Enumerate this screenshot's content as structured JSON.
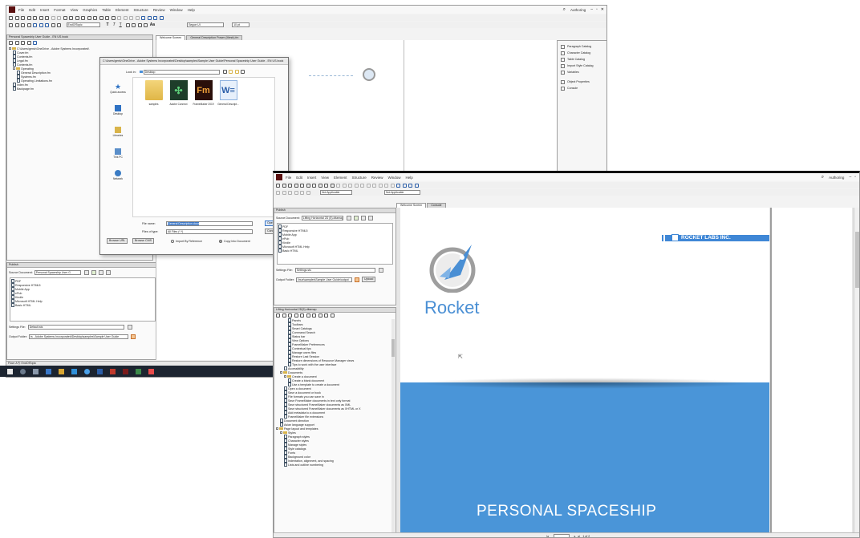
{
  "win1": {
    "menu": [
      "File",
      "Edit",
      "Insert",
      "Format",
      "View",
      "Graphics",
      "Table",
      "Element",
      "Structure",
      "Review",
      "Window",
      "Help"
    ],
    "workspace": "Authoring",
    "tb_style": "EndOfTopic",
    "tb_font": "Segoe UI",
    "tb_size": "10 pt",
    "tabs": [
      "Welcome Screen",
      "General Description Power (Mesh).fm"
    ],
    "left_panel_title": "Personal Spaceship User Guide - EN US.book",
    "tree": [
      {
        "label": "C:\\Users\\gentz\\OneDrive - Adobe Systems Incorporated\\",
        "depth": 0,
        "kind": "folder"
      },
      {
        "label": "Cover.fm",
        "depth": 1,
        "kind": "doc"
      },
      {
        "label": "Contents.fm",
        "depth": 1,
        "kind": "doc"
      },
      {
        "label": "Legal.fm",
        "depth": 1,
        "kind": "doc"
      },
      {
        "label": "Contents.fm",
        "depth": 1,
        "kind": "doc"
      },
      {
        "label": "Operating",
        "depth": 1,
        "kind": "folder"
      },
      {
        "label": "General Description.fm",
        "depth": 2,
        "kind": "doc"
      },
      {
        "label": "Systems.fm",
        "depth": 2,
        "kind": "doc"
      },
      {
        "label": "Operating Limitations.fm",
        "depth": 2,
        "kind": "doc"
      },
      {
        "label": "Index.fm",
        "depth": 1,
        "kind": "doc"
      },
      {
        "label": "Backpage.fm",
        "depth": 1,
        "kind": "doc"
      }
    ],
    "publish": {
      "title": "Publish",
      "source_label": "Source Document:",
      "source_value": "Personal Spaceship User G",
      "formats": [
        "PDF",
        "Responsive HTML5",
        "Mobile App",
        "ePub",
        "Kindle",
        "Microsoft HTML Help",
        "Basic HTML"
      ],
      "settings_label": "Settings File:",
      "settings_value": "Default.sts",
      "output_label": "Output Folder:",
      "output_value": "ts - Adobe Systems Incorporated\\Desktop\\samples\\Sample User Guide"
    },
    "statusbar": "Flow: A  ¶: EndOfTopic",
    "right_panel": [
      "Paragraph Catalog",
      "Character Catalog",
      "Table Catalog",
      "Import Style Catalog",
      "Variables",
      "Object Properties",
      "Console"
    ]
  },
  "dialog": {
    "path": "C:\\Users\\gentz\\OneDrive - Adobe Systems Incorporated\\Desktop\\samples\\Sample User Guide\\Personal Spaceship User Guide - EN US.book",
    "lookin_label": "Look in:",
    "lookin_value": "Desktop",
    "sidebar": [
      "Quick access",
      "Desktop",
      "Libraries",
      "This PC",
      "Network"
    ],
    "files": [
      {
        "label": "samples",
        "kind": "folder"
      },
      {
        "label": "Adobe Connect",
        "kind": "connect"
      },
      {
        "label": "FrameMaker 2019",
        "kind": "fm"
      },
      {
        "label": "General Descript...",
        "kind": "word"
      }
    ],
    "filename_label": "File name:",
    "filename_value": "General Description.docx",
    "filetype_label": "Files of type:",
    "filetype_value": "All Files (*.*)",
    "browse_left": "Browse URL",
    "browse_right": "Browse CMS",
    "import_ref": "Import By Reference",
    "copy_doc": "Copy Into Document",
    "open_btn": "Open",
    "cancel_btn": "Cancel"
  },
  "win2": {
    "menu": [
      "File",
      "Edit",
      "Insert",
      "View",
      "Element",
      "Structure",
      "Review",
      "Window",
      "Help"
    ],
    "workspace": "Authoring",
    "tb_style": "Not Applicable",
    "tb_font": "Not Applicable",
    "tabs": [
      "Welcome Screen",
      "Console"
    ],
    "publish": {
      "title": "Publish",
      "source_label": "Source Document:",
      "source_value": "Lifting Horizontal 2D (5).ditamap",
      "formats": [
        "PDF",
        "Responsive HTML5",
        "Mobile App",
        "ePub",
        "Kindle",
        "Microsoft HTML Help",
        "Basic HTML"
      ],
      "settings_label": "Settings File:",
      "settings_value": "Settings.sts",
      "output_label": "Output Folder:",
      "output_value": "\\inux\\samples\\Sample User Guide\\output",
      "output_btn": "Upload"
    },
    "map_title": "Lifting Horizontal 2D(5).ditamap",
    "map_tree": [
      {
        "label": "Panels",
        "depth": 3,
        "kind": "doc"
      },
      {
        "label": "Toolbars",
        "depth": 3,
        "kind": "doc"
      },
      {
        "label": "Smart Catalogs",
        "depth": 3,
        "kind": "doc"
      },
      {
        "label": "Command Search",
        "depth": 3,
        "kind": "doc"
      },
      {
        "label": "Status bar",
        "depth": 3,
        "kind": "doc"
      },
      {
        "label": "View Options",
        "depth": 3,
        "kind": "doc"
      },
      {
        "label": "FrameMaker Preferences",
        "depth": 3,
        "kind": "doc"
      },
      {
        "label": "Contextual tips",
        "depth": 3,
        "kind": "doc"
      },
      {
        "label": "Manage users files",
        "depth": 3,
        "kind": "doc"
      },
      {
        "label": "Restore Last Session",
        "depth": 3,
        "kind": "doc"
      },
      {
        "label": "Restore dimensions of Resource Manager views",
        "depth": 3,
        "kind": "doc"
      },
      {
        "label": "Tips to work with the user interface",
        "depth": 3,
        "kind": "doc"
      },
      {
        "label": "Accessibility",
        "depth": 2,
        "kind": "doc"
      },
      {
        "label": "Documents",
        "depth": 1,
        "kind": "folder"
      },
      {
        "label": "Create a document",
        "depth": 2,
        "kind": "folder"
      },
      {
        "label": "Create a blank document",
        "depth": 3,
        "kind": "doc"
      },
      {
        "label": "Use a template to create a document",
        "depth": 3,
        "kind": "doc"
      },
      {
        "label": "Open a document",
        "depth": 2,
        "kind": "doc"
      },
      {
        "label": "Save a document or book",
        "depth": 2,
        "kind": "doc"
      },
      {
        "label": "File formats you can save in",
        "depth": 2,
        "kind": "doc"
      },
      {
        "label": "Save FrameMaker documents in text only format",
        "depth": 2,
        "kind": "doc"
      },
      {
        "label": "Save structured FrameMaker documents as XML",
        "depth": 2,
        "kind": "doc"
      },
      {
        "label": "Save structured FrameMaker documents as XHTML or X",
        "depth": 2,
        "kind": "doc"
      },
      {
        "label": "Add metadata to a document",
        "depth": 2,
        "kind": "doc"
      },
      {
        "label": "FrameMaker file extensions",
        "depth": 2,
        "kind": "doc"
      },
      {
        "label": "Document direction",
        "depth": 1,
        "kind": "doc"
      },
      {
        "label": "Asian language support",
        "depth": 1,
        "kind": "doc"
      },
      {
        "label": "Page layout and templates",
        "depth": 0,
        "kind": "folder"
      },
      {
        "label": "Styles",
        "depth": 1,
        "kind": "folder"
      },
      {
        "label": "Paragraph styles",
        "depth": 2,
        "kind": "doc"
      },
      {
        "label": "Character styles",
        "depth": 2,
        "kind": "doc"
      },
      {
        "label": "Manage styles",
        "depth": 2,
        "kind": "doc"
      },
      {
        "label": "Style catalogs",
        "depth": 2,
        "kind": "doc"
      },
      {
        "label": "Fonts",
        "depth": 2,
        "kind": "doc"
      },
      {
        "label": "Background color",
        "depth": 2,
        "kind": "doc"
      },
      {
        "label": "Indentation, alignment, and spacing",
        "depth": 2,
        "kind": "doc"
      },
      {
        "label": "Lists and outline numbering",
        "depth": 2,
        "kind": "doc"
      }
    ],
    "page": {
      "brand": "ROCKET LABS INC.",
      "logo_word": "Rocket",
      "headline": "PERSONAL SPACESHIP"
    },
    "page_nav": "1 of 2",
    "colors": {
      "accent": "#4a8fd4",
      "frame": "#5a1010"
    }
  }
}
